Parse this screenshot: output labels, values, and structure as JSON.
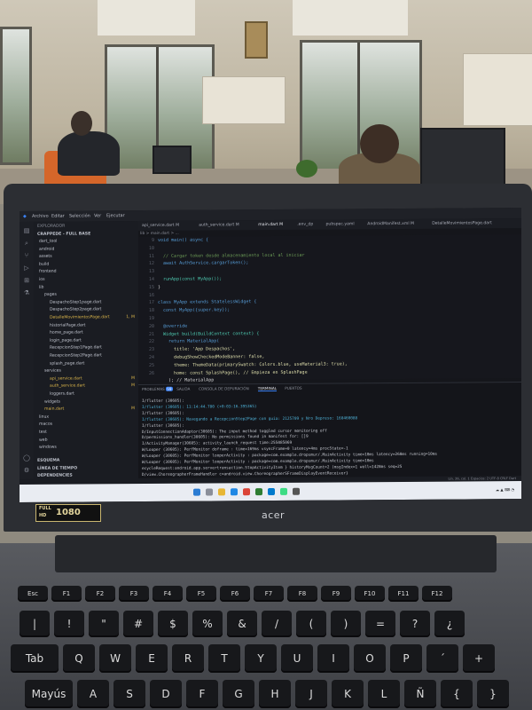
{
  "vscode": {
    "menu": [
      "Archivo",
      "Editar",
      "Selección",
      "Ver",
      "Ejecutar"
    ],
    "explorer_title": "EXPLORADOR",
    "project_title": "CRAPPEDE - FULL BASE",
    "tree_items": [
      {
        "label": "dart_tool",
        "badge": ""
      },
      {
        "label": "android",
        "badge": ""
      },
      {
        "label": "assets",
        "badge": ""
      },
      {
        "label": "build",
        "badge": ""
      },
      {
        "label": "frontend",
        "badge": ""
      },
      {
        "label": "ios",
        "badge": ""
      },
      {
        "label": "lib",
        "badge": ""
      },
      {
        "label": "pages",
        "badge": ""
      },
      {
        "label": "DespachoStep1page.dart",
        "badge": ""
      },
      {
        "label": "DespachoStep2page.dart",
        "badge": ""
      },
      {
        "label": "DetalleMovimientosPage.dart",
        "badge": "1, M"
      },
      {
        "label": "historialPage.dart",
        "badge": ""
      },
      {
        "label": "home_page.dart",
        "badge": ""
      },
      {
        "label": "login_page.dart",
        "badge": ""
      },
      {
        "label": "RecepcionStep1Page.dart",
        "badge": ""
      },
      {
        "label": "RecepcionStep2Page.dart",
        "badge": ""
      },
      {
        "label": "splash_page.dart",
        "badge": ""
      },
      {
        "label": "services",
        "badge": ""
      },
      {
        "label": "api_service.dart",
        "badge": "M"
      },
      {
        "label": "auth_service.dart",
        "badge": "M"
      },
      {
        "label": "loggers.dart",
        "badge": ""
      },
      {
        "label": "widgets",
        "badge": ""
      },
      {
        "label": "main.dart",
        "badge": "M"
      },
      {
        "label": "linux",
        "badge": ""
      },
      {
        "label": "macos",
        "badge": ""
      },
      {
        "label": "test",
        "badge": ""
      },
      {
        "label": "web",
        "badge": ""
      },
      {
        "label": "windows",
        "badge": ""
      }
    ],
    "outline_items": [
      "ESQUEMA",
      "LÍNEA DE TIEMPO",
      "DEPENDENCIES"
    ],
    "tabs": [
      "api_service.dart M",
      "auth_service.dart M",
      "main.dart M",
      ".env_dp",
      "pubspec.yaml",
      "AndroidManifest.xml M",
      "DetalleMovimientosPage.dart"
    ],
    "breadcrumb": "lib > main.dart > ...",
    "line_numbers": [
      "9",
      "10",
      "11",
      "12",
      "13",
      "14",
      "15",
      "16",
      "17",
      "18",
      "19",
      "20",
      "21",
      "22",
      "23",
      "24",
      "25",
      "26"
    ],
    "code_lines": [
      "void main() async {",
      "",
      "  // Cargar token desde almacenamiento local al iniciar",
      "  await AuthService.cargarToken();",
      "",
      "  runApp(const MyApp());",
      "}",
      "",
      "class MyApp extends StatelessWidget {",
      "  const MyApp({super.key});",
      "",
      "  @override",
      "  Widget build(BuildContext context) {",
      "    return MaterialApp(",
      "      title: 'App Despachos',",
      "      debugShowCheckedModeBanner: false,",
      "      theme: ThemeData(primarySwatch: Colors.blue, useMaterial3: true),",
      "      home: const SplashPage(), // Empieza en SplashPage",
      "    ); // MaterialApp",
      "  }",
      "}"
    ],
    "panel_tabs": [
      "PROBLEMAS",
      "SALIDA",
      "CONSOLA DE DEPURACIÓN",
      "TERMINAL",
      "PUERTOS"
    ],
    "problems_count": "59",
    "terminal_lines": [
      "I/flutter (30605):",
      "I/flutter (30605):  11:14:44.780 (+0:03:16.395365)",
      "I/flutter (30605):",
      "I/flutter (30605):  Navegando a RecepcionStep2Page con guía: 2125709 y Nro Depreso: 160460088",
      "I/flutter (30605):",
      "D/InputConnectionAdaptor(30605): The input method toggled cursor monitoring off",
      "D/permissions_handler(30605): No permissions found in manifest for: []9",
      "I/ActivityManager(30605): activity_launch_request time:255085069",
      "W/Looper (30605): PerfMonitor doframe : time=169ms vsyncFrame=0 latency=4ms procState=-1",
      "W/Looper (30605): PerfMonitor looperActivity : package=com.example.dropsmur/.MainActivity time=10ms latency=260ms running=10ms",
      "W/Looper (30605): PerfMonitor looperActivity : package=com.example.dropsmur/.MainActivity time=10ms",
      "ecycleRequest:android.app.servertransaction.StopActivityItem } historyMsgCount=2 (msgIndex=1 wall=1428ms seq=25",
      "D/view.ChoreographerFrameHandler c=android.view.ChoreographerSFrameDisplayEventReceiver}"
    ],
    "status_text": "Lín. 26, col. 1   Espacios: 2   UTF-8   CRLF   Dart"
  },
  "sticker": {
    "left": "FULL HD",
    "number": "1080"
  },
  "brand": "acer",
  "keyboard_rows": [
    [
      "Esc",
      "F1",
      "F2",
      "F3",
      "F4",
      "F5",
      "F6",
      "F7",
      "F8",
      "F9",
      "F10",
      "F11",
      "F12"
    ],
    [
      "|",
      "!",
      "\"",
      "#",
      "$",
      "%",
      "&",
      "/",
      "(",
      ")",
      "=",
      "?",
      "¿"
    ],
    [
      "Tab",
      "Q",
      "W",
      "E",
      "R",
      "T",
      "Y",
      "U",
      "I",
      "O",
      "P",
      "´",
      "+"
    ],
    [
      "Mayús",
      "A",
      "S",
      "D",
      "F",
      "G",
      "H",
      "J",
      "K",
      "L",
      "Ñ",
      "{",
      "}"
    ]
  ],
  "colors": {
    "code_keyword": "#569cd6",
    "code_type": "#4ec9b0",
    "code_string": "#ce9178",
    "code_comment": "#6a9955",
    "code_function": "#dcdcaa",
    "code_default": "#d4d4d4"
  }
}
